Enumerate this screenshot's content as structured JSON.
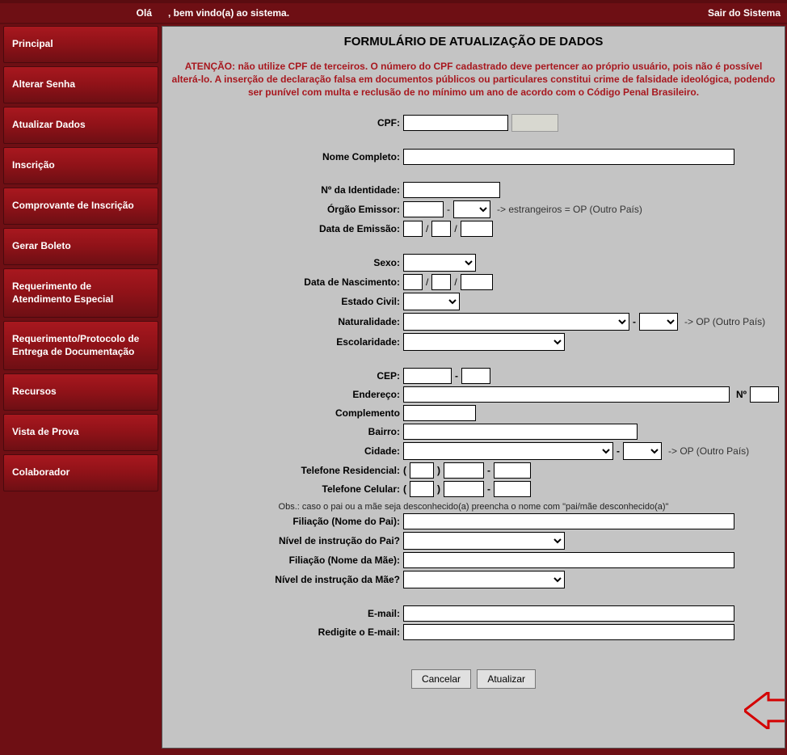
{
  "topbar": {
    "greeting_left": "Olá",
    "greeting_center": ", bem vindo(a) ao sistema.",
    "logout": "Sair do Sistema"
  },
  "sidebar": {
    "items": [
      "Principal",
      "Alterar Senha",
      "Atualizar Dados",
      "Inscrição",
      "Comprovante de Inscrição",
      "Gerar Boleto",
      "Requerimento de Atendimento Especial",
      "Requerimento/Protocolo de Entrega de Documentação",
      "Recursos",
      "Vista de Prova",
      "Colaborador"
    ]
  },
  "form": {
    "title": "FORMULÁRIO DE ATUALIZAÇÃO DE DADOS",
    "warning": "ATENÇÃO: não utilize CPF de terceiros. O número do CPF cadastrado deve pertencer ao próprio usuário, pois não é possível alterá-lo. A inserção de declaração falsa em documentos públicos ou particulares constitui crime de falsidade ideológica, podendo ser punível com multa e reclusão de no mínimo um ano de acordo com o Código Penal Brasileiro.",
    "labels": {
      "cpf": "CPF:",
      "nome": "Nome Completo:",
      "identidade": "Nº da Identidade:",
      "orgao": "Órgão Emissor:",
      "orgao_hint": "-> estrangeiros = OP (Outro País)",
      "data_emissao": "Data de Emissão:",
      "sexo": "Sexo:",
      "data_nasc": "Data de Nascimento:",
      "estado_civil": "Estado Civil:",
      "naturalidade": "Naturalidade:",
      "escolaridade": "Escolaridade:",
      "op_hint": "-> OP (Outro País)",
      "cep": "CEP:",
      "endereco": "Endereço:",
      "numero": "Nº",
      "complemento": "Complemento",
      "bairro": "Bairro:",
      "cidade": "Cidade:",
      "tel_res": "Telefone Residencial:",
      "tel_cel": "Telefone Celular:",
      "obs": "Obs.: caso o pai ou a mãe seja desconhecido(a) preencha o nome com \"pai/mãe desconhecido(a)\"",
      "filiacao_pai": "Filiação (Nome do Pai):",
      "instrucao_pai": "Nível de instrução do Pai?",
      "filiacao_mae": "Filiação (Nome da Mãe):",
      "instrucao_mae": "Nível de instrução da Mãe?",
      "email": "E-mail:",
      "email2": "Redigite o E-mail:",
      "dash": "-",
      "slash": "/",
      "paren_open": "(",
      "paren_close": ")"
    },
    "buttons": {
      "cancel": "Cancelar",
      "update": "Atualizar"
    }
  }
}
